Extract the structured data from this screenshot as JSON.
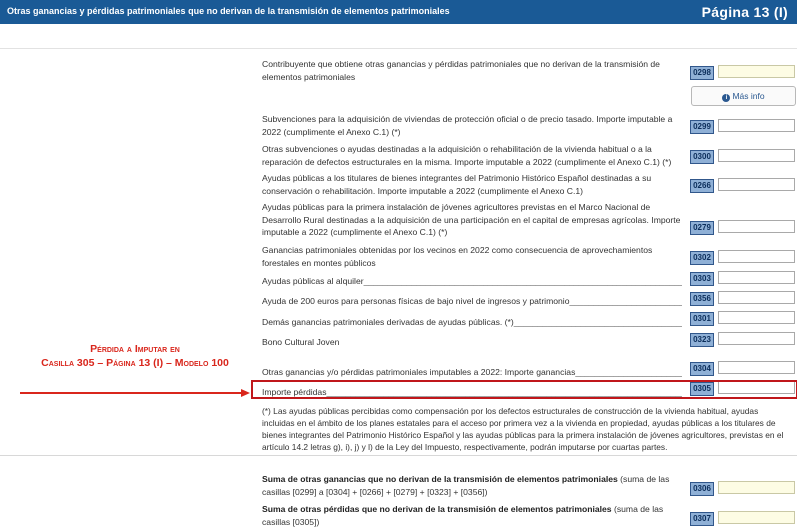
{
  "header": {
    "title": "Otras ganancias y pérdidas patrimoniales que no derivan de la transmisión de elementos patrimoniales",
    "page_label": "Página 13 (I)"
  },
  "contribuyente": {
    "label": "Contribuyente que obtiene otras ganancias y pérdidas patrimoniales que no derivan de la transmisión de elementos patrimoniales",
    "code": "0298",
    "value": ""
  },
  "info_button": {
    "label": "Más info",
    "icon": "info-circle-icon"
  },
  "rows": [
    {
      "label": "Subvenciones para la adquisición de viviendas de protección oficial o de precio tasado. Importe imputable a 2022 (cumplimente el Anexo C.1) (*)",
      "code": "0299",
      "value": ""
    },
    {
      "label": "Otras subvenciones o ayudas destinadas a la adquisición o rehabilitación de la vivienda habitual o a la reparación de defectos estructurales en la misma. Importe imputable a 2022 (cumplimente el Anexo C.1) (*)",
      "code": "0300",
      "value": ""
    },
    {
      "label": "Ayudas públicas a los titulares de bienes integrantes del Patrimonio Histórico Español destinadas a su conservación o rehabilitación. Importe imputable a 2022 (cumplimente el Anexo C.1)",
      "code": "0266",
      "value": ""
    },
    {
      "label": "Ayudas públicas para la primera instalación de jóvenes agricultores previstas en el Marco Nacional de Desarrollo Rural destinadas a la adquisición de una participación en el capital de empresas agrícolas. Importe imputable a 2022 (cumplimente el Anexo C.1) (*)",
      "code": "0279",
      "value": ""
    },
    {
      "label": "Ganancias patrimoniales obtenidas por los vecinos en 2022 como consecuencia de aprovechamientos forestales en montes públicos",
      "code": "0302",
      "value": ""
    },
    {
      "label": "Ayudas públicas al alquiler",
      "code": "0303",
      "value": ""
    },
    {
      "label": "Ayuda de 200 euros para personas físicas de bajo nivel de ingresos y patrimonio",
      "code": "0356",
      "value": ""
    },
    {
      "label": "Demás ganancias patrimoniales derivadas de ayudas públicas. (*)",
      "code": "0301",
      "value": ""
    },
    {
      "label": "Bono Cultural Joven",
      "code": "0323",
      "value": ""
    },
    {
      "label": "Otras ganancias y/o pérdidas patrimoniales imputables a 2022: Importe ganancias",
      "code": "0304",
      "value": ""
    },
    {
      "label": "Importe pérdidas",
      "code": "0305",
      "value": ""
    }
  ],
  "annotation": {
    "line1": "Pérdida a Imputar en",
    "line2": "Casilla 305 – Página 13 (I) – Modelo 100"
  },
  "note": "(*) Las ayudas públicas percibidas como compensación por los defectos estructurales de construcción de la vivienda habitual, ayudas incluidas en el ámbito de los planes estatales para el acceso por primera vez a la vivienda en propiedad, ayudas públicas a los titulares de bienes integrantes del Patrimonio Histórico Español y las ayudas públicas para la primera instalación de jóvenes agricultores, previstas en el artículo 14.2 letras g), i), j) y l) de la Ley del Impuesto, respectivamente, podrán imputarse por cuartas partes.",
  "sums": [
    {
      "bold": "Suma de otras ganancias que no derivan de la transmisión de elementos patrimoniales",
      "rest": " (suma de las casillas [0299] a [0304] + [0266] + [0279] + [0323] + [0356])",
      "code": "0306",
      "value": ""
    },
    {
      "bold": "Suma de otras pérdidas que no derivan de la transmisión de elementos patrimoniales",
      "rest": " (suma de las casillas [0305])",
      "code": "0307",
      "value": ""
    }
  ],
  "colors": {
    "header_bg": "#1a5a96",
    "code_bg": "#8fb0d6",
    "highlight": "#c0171b",
    "annotation": "#d9261c"
  }
}
